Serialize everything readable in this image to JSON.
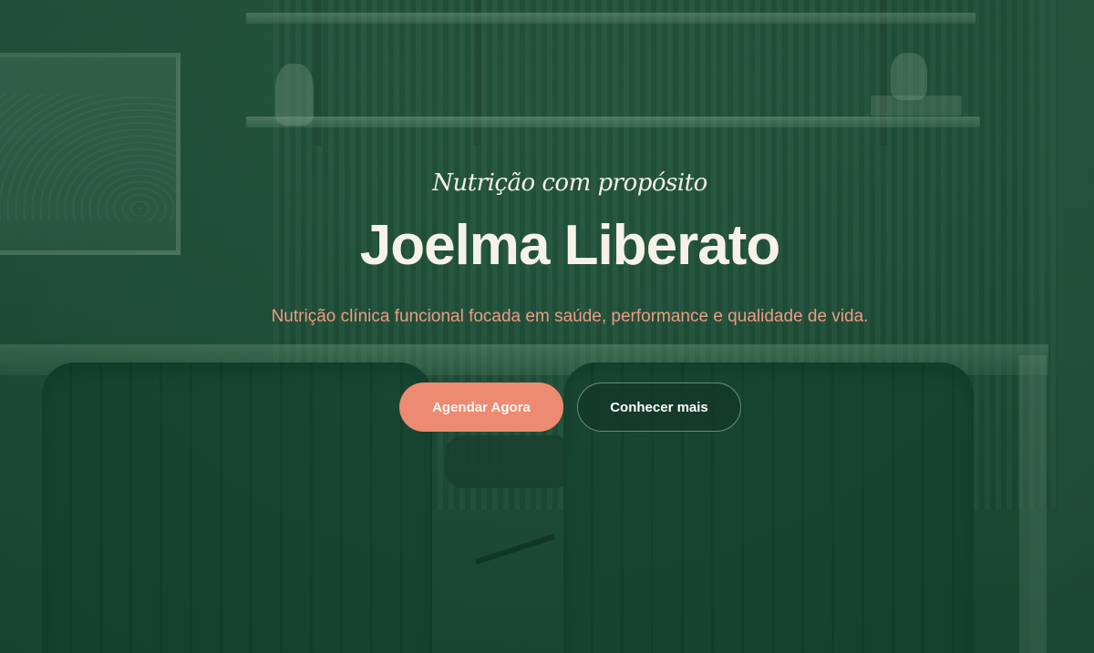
{
  "hero": {
    "kicker": "Nutrição com propósito",
    "title": "Joelma Liberato",
    "subtitle": "Nutrição clínica funcional focada em saúde, performance e qualidade de vida.",
    "primary_cta": "Agendar Agora",
    "secondary_cta": "Conhecer mais"
  },
  "colors": {
    "overlay_green": "#1f4b38",
    "accent_coral": "#ec8a72",
    "subtitle_coral": "#ee9b82",
    "text_light": "#f6f2ea"
  }
}
